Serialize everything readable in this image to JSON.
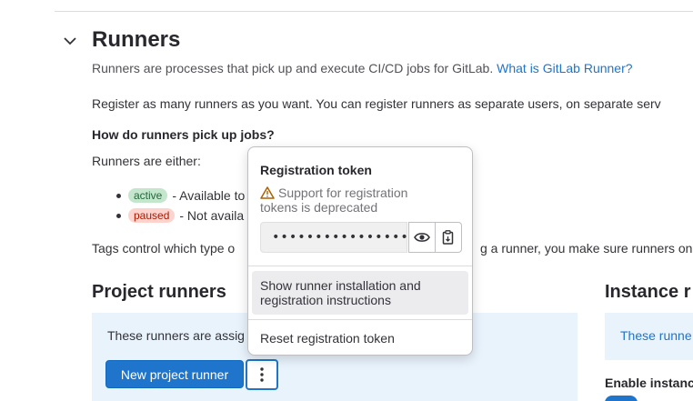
{
  "section": {
    "title": "Runners",
    "description": "Runners are processes that pick up and execute CI/CD jobs for GitLab.",
    "description_link": "What is GitLab Runner?",
    "register_text": "Register as many runners as you want. You can register runners as separate users, on separate serv",
    "how_heading": "How do runners pick up jobs?",
    "either_text": "Runners are either:",
    "bullets": [
      {
        "badge": "active",
        "text": "- Available to"
      },
      {
        "badge": "paused",
        "text": "- Not availa"
      }
    ],
    "tags_text_left": "Tags control which type o",
    "tags_text_right": "g a runner, you make sure runners on"
  },
  "project_runners": {
    "heading": "Project runners",
    "alert_text": "These runners are assig",
    "new_button": "New project runner"
  },
  "instance_runners": {
    "heading": "Instance r",
    "alert_text": "These runne",
    "enable_label": "Enable instanc"
  },
  "dropdown": {
    "title": "Registration token",
    "warning": "Support for registration tokens is deprecated",
    "token_masked": "••••••••••••••••",
    "items": [
      "Show runner installation and registration instructions",
      "Reset registration token"
    ]
  },
  "colors": {
    "primary": "#1f75cb",
    "alert_bg": "#e9f3fc",
    "active_badge_bg": "#c3e6cd",
    "paused_badge_bg": "#fdd4cd",
    "warning": "#ab6100"
  },
  "icons": [
    "chevron-down-icon",
    "warning-icon",
    "eye-icon",
    "copy-to-clipboard-icon",
    "ellipsis-v-icon"
  ]
}
